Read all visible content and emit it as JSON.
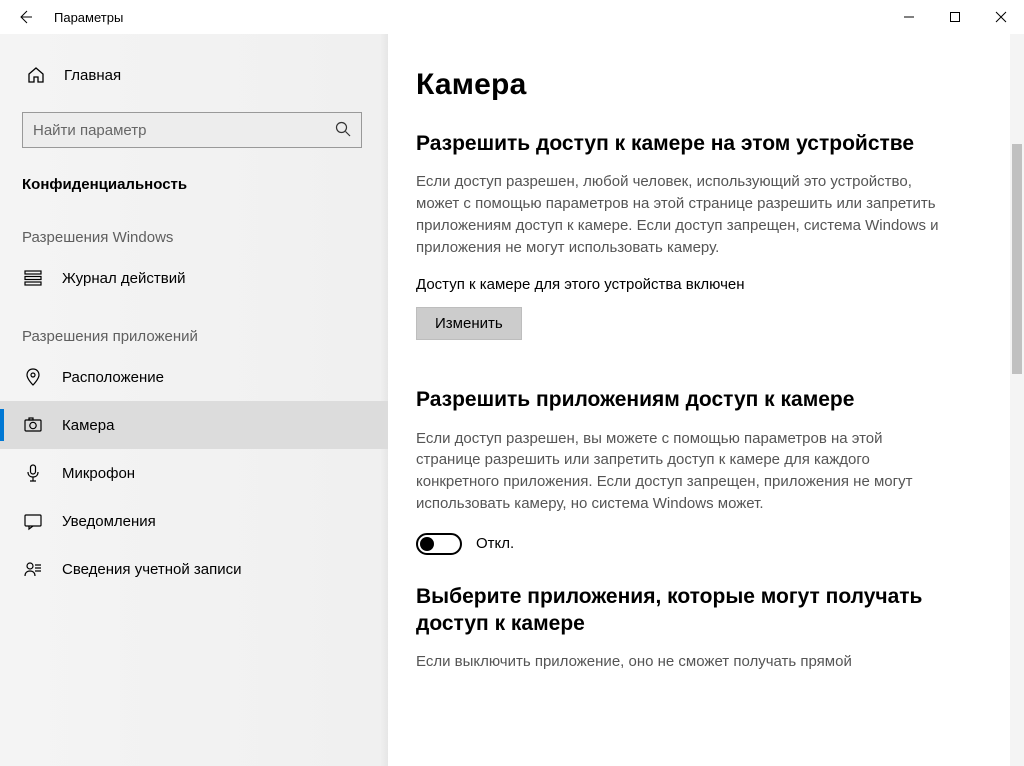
{
  "titlebar": {
    "title": "Параметры"
  },
  "sidebar": {
    "home": "Главная",
    "search_placeholder": "Найти параметр",
    "section_title": "Конфиденциальность",
    "group_windows": "Разрешения Windows",
    "group_apps": "Разрешения приложений",
    "items_windows": [
      {
        "label": "Журнал действий"
      }
    ],
    "items_apps": [
      {
        "label": "Расположение"
      },
      {
        "label": "Камера"
      },
      {
        "label": "Микрофон"
      },
      {
        "label": "Уведомления"
      },
      {
        "label": "Сведения учетной записи"
      }
    ]
  },
  "content": {
    "page_title": "Камера",
    "section1_h": "Разрешить доступ к камере на этом устройстве",
    "section1_p": "Если доступ разрешен, любой человек, использующий это устройство, может с помощью параметров на этой странице разрешить или запретить приложениям доступ к камере. Если доступ запрещен, система Windows и приложения не могут использовать камеру.",
    "access_status": "Доступ к камере для этого устройства включен",
    "change_btn": "Изменить",
    "section2_h": "Разрешить приложениям доступ к камере",
    "section2_p": "Если доступ разрешен, вы можете с помощью параметров на этой странице разрешить или запретить доступ к камере для каждого конкретного приложения. Если доступ запрещен, приложения не могут использовать камеру, но система Windows может.",
    "toggle_label": "Откл.",
    "section3_h": "Выберите приложения, которые могут получать доступ к камере",
    "section3_p": "Если выключить приложение, оно не сможет получать прямой"
  }
}
